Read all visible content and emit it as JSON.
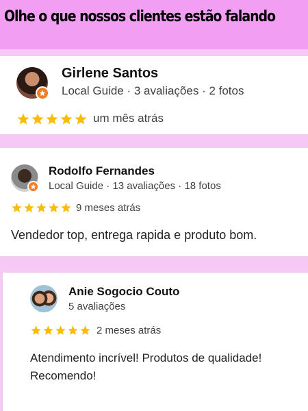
{
  "header": {
    "title": "Olhe o que nossos clientes estão falando"
  },
  "colors": {
    "header_bg": "#f29ef2",
    "page_bg": "#f6c8f6",
    "star": "#fbbc04",
    "badge": "#f47b20"
  },
  "reviews": [
    {
      "name": "Girlene Santos",
      "meta": "Local Guide · 3 avaliações · 2 fotos",
      "rating": 5,
      "time": "um mês atrás",
      "text": "",
      "avatar_icon": "user-photo",
      "local_guide_badge": true
    },
    {
      "name": "Rodolfo Fernandes",
      "meta": "Local Guide · 13 avaliações · 18 fotos",
      "rating": 5,
      "time": "9 meses atrás",
      "text": "Vendedor top, entrega rapida e produto bom.",
      "avatar_icon": "user-photo",
      "local_guide_badge": true
    },
    {
      "name": "Anie Sogocio Couto",
      "meta": "5 avaliações",
      "rating": 5,
      "time": "2 meses atrás",
      "text": "Atendimento incrível! Produtos de qualidade! Recomendo!",
      "avatar_icon": "user-photo",
      "local_guide_badge": false
    }
  ]
}
